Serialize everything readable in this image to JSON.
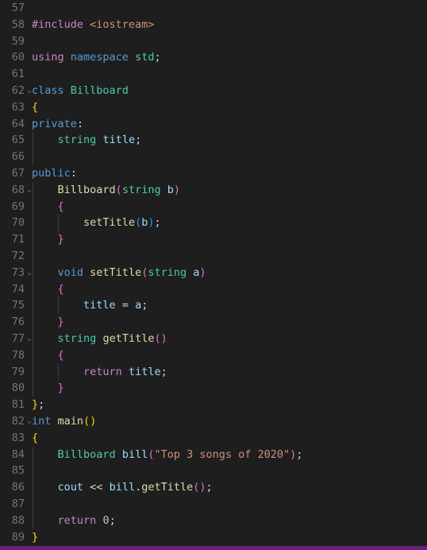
{
  "editor": {
    "language": "cpp",
    "theme": "dark-plus",
    "background_color": "#1e1e1e",
    "line_number_color": "#6e7681",
    "status_bar_color": "#68217a",
    "first_visible_line": 57,
    "last_visible_line": 89,
    "fold_chevron": "⌄",
    "lines": [
      {
        "num": "57",
        "fold": false,
        "guides": 0,
        "tokens": []
      },
      {
        "num": "58",
        "fold": false,
        "guides": 0,
        "tokens": [
          {
            "t": "#include ",
            "c": "t-pre"
          },
          {
            "t": "<iostream>",
            "c": "t-str"
          }
        ]
      },
      {
        "num": "59",
        "fold": false,
        "guides": 0,
        "tokens": []
      },
      {
        "num": "60",
        "fold": false,
        "guides": 0,
        "tokens": [
          {
            "t": "using ",
            "c": "t-pre"
          },
          {
            "t": "namespace ",
            "c": "t-kw"
          },
          {
            "t": "std",
            "c": "t-type"
          },
          {
            "t": ";",
            "c": "t-plain"
          }
        ]
      },
      {
        "num": "61",
        "fold": false,
        "guides": 0,
        "tokens": []
      },
      {
        "num": "62",
        "fold": true,
        "guides": 0,
        "tokens": [
          {
            "t": "class ",
            "c": "t-kw"
          },
          {
            "t": "Billboard",
            "c": "t-type"
          }
        ]
      },
      {
        "num": "63",
        "fold": false,
        "guides": 0,
        "tokens": [
          {
            "t": "{",
            "c": "t-br1"
          }
        ]
      },
      {
        "num": "64",
        "fold": false,
        "guides": 0,
        "tokens": [
          {
            "t": "private",
            "c": "t-kw"
          },
          {
            "t": ":",
            "c": "t-plain"
          }
        ]
      },
      {
        "num": "65",
        "fold": false,
        "guides": 1,
        "tokens": [
          {
            "t": "    ",
            "c": "t-plain"
          },
          {
            "t": "string",
            "c": "t-type"
          },
          {
            "t": " ",
            "c": "t-plain"
          },
          {
            "t": "title",
            "c": "t-var"
          },
          {
            "t": ";",
            "c": "t-plain"
          }
        ]
      },
      {
        "num": "66",
        "fold": false,
        "guides": 1,
        "tokens": []
      },
      {
        "num": "67",
        "fold": false,
        "guides": 0,
        "tokens": [
          {
            "t": "public",
            "c": "t-kw"
          },
          {
            "t": ":",
            "c": "t-plain"
          }
        ]
      },
      {
        "num": "68",
        "fold": true,
        "guides": 1,
        "tokens": [
          {
            "t": "    ",
            "c": "t-plain"
          },
          {
            "t": "Billboard",
            "c": "t-fn"
          },
          {
            "t": "(",
            "c": "t-br2"
          },
          {
            "t": "string",
            "c": "t-type"
          },
          {
            "t": " ",
            "c": "t-plain"
          },
          {
            "t": "b",
            "c": "t-var"
          },
          {
            "t": ")",
            "c": "t-br2"
          }
        ]
      },
      {
        "num": "69",
        "fold": false,
        "guides": 1,
        "tokens": [
          {
            "t": "    ",
            "c": "t-plain"
          },
          {
            "t": "{",
            "c": "t-br2"
          }
        ]
      },
      {
        "num": "70",
        "fold": false,
        "guides": 2,
        "tokens": [
          {
            "t": "        ",
            "c": "t-plain"
          },
          {
            "t": "setTitle",
            "c": "t-fn"
          },
          {
            "t": "(",
            "c": "t-br3"
          },
          {
            "t": "b",
            "c": "t-var"
          },
          {
            "t": ")",
            "c": "t-br3"
          },
          {
            "t": ";",
            "c": "t-plain"
          }
        ]
      },
      {
        "num": "71",
        "fold": false,
        "guides": 1,
        "tokens": [
          {
            "t": "    ",
            "c": "t-plain"
          },
          {
            "t": "}",
            "c": "t-br2"
          }
        ]
      },
      {
        "num": "72",
        "fold": false,
        "guides": 1,
        "tokens": []
      },
      {
        "num": "73",
        "fold": true,
        "guides": 1,
        "tokens": [
          {
            "t": "    ",
            "c": "t-plain"
          },
          {
            "t": "void",
            "c": "t-kw"
          },
          {
            "t": " ",
            "c": "t-plain"
          },
          {
            "t": "setTitle",
            "c": "t-fn"
          },
          {
            "t": "(",
            "c": "t-br2"
          },
          {
            "t": "string",
            "c": "t-type"
          },
          {
            "t": " ",
            "c": "t-plain"
          },
          {
            "t": "a",
            "c": "t-var"
          },
          {
            "t": ")",
            "c": "t-br2"
          }
        ]
      },
      {
        "num": "74",
        "fold": false,
        "guides": 1,
        "tokens": [
          {
            "t": "    ",
            "c": "t-plain"
          },
          {
            "t": "{",
            "c": "t-br2"
          }
        ]
      },
      {
        "num": "75",
        "fold": false,
        "guides": 2,
        "tokens": [
          {
            "t": "        ",
            "c": "t-plain"
          },
          {
            "t": "title",
            "c": "t-var"
          },
          {
            "t": " ",
            "c": "t-plain"
          },
          {
            "t": "=",
            "c": "t-plain"
          },
          {
            "t": " ",
            "c": "t-plain"
          },
          {
            "t": "a",
            "c": "t-var"
          },
          {
            "t": ";",
            "c": "t-plain"
          }
        ]
      },
      {
        "num": "76",
        "fold": false,
        "guides": 1,
        "tokens": [
          {
            "t": "    ",
            "c": "t-plain"
          },
          {
            "t": "}",
            "c": "t-br2"
          }
        ]
      },
      {
        "num": "77",
        "fold": true,
        "guides": 1,
        "tokens": [
          {
            "t": "    ",
            "c": "t-plain"
          },
          {
            "t": "string",
            "c": "t-type"
          },
          {
            "t": " ",
            "c": "t-plain"
          },
          {
            "t": "getTitle",
            "c": "t-fn"
          },
          {
            "t": "(",
            "c": "t-br2"
          },
          {
            "t": ")",
            "c": "t-br2"
          }
        ]
      },
      {
        "num": "78",
        "fold": false,
        "guides": 1,
        "tokens": [
          {
            "t": "    ",
            "c": "t-plain"
          },
          {
            "t": "{",
            "c": "t-br2"
          }
        ]
      },
      {
        "num": "79",
        "fold": false,
        "guides": 2,
        "tokens": [
          {
            "t": "        ",
            "c": "t-plain"
          },
          {
            "t": "return",
            "c": "t-pre"
          },
          {
            "t": " ",
            "c": "t-plain"
          },
          {
            "t": "title",
            "c": "t-var"
          },
          {
            "t": ";",
            "c": "t-plain"
          }
        ]
      },
      {
        "num": "80",
        "fold": false,
        "guides": 1,
        "tokens": [
          {
            "t": "    ",
            "c": "t-plain"
          },
          {
            "t": "}",
            "c": "t-br2"
          }
        ]
      },
      {
        "num": "81",
        "fold": false,
        "guides": 0,
        "tokens": [
          {
            "t": "}",
            "c": "t-br1"
          },
          {
            "t": ";",
            "c": "t-plain"
          }
        ]
      },
      {
        "num": "82",
        "fold": true,
        "guides": 0,
        "tokens": [
          {
            "t": "int",
            "c": "t-kw"
          },
          {
            "t": " ",
            "c": "t-plain"
          },
          {
            "t": "main",
            "c": "t-fn"
          },
          {
            "t": "(",
            "c": "t-br1"
          },
          {
            "t": ")",
            "c": "t-br1"
          }
        ]
      },
      {
        "num": "83",
        "fold": false,
        "guides": 0,
        "tokens": [
          {
            "t": "{",
            "c": "t-br1"
          }
        ]
      },
      {
        "num": "84",
        "fold": false,
        "guides": 1,
        "tokens": [
          {
            "t": "    ",
            "c": "t-plain"
          },
          {
            "t": "Billboard",
            "c": "t-type"
          },
          {
            "t": " ",
            "c": "t-plain"
          },
          {
            "t": "bill",
            "c": "t-var"
          },
          {
            "t": "(",
            "c": "t-br2"
          },
          {
            "t": "\"Top 3 songs of 2020\"",
            "c": "t-str"
          },
          {
            "t": ")",
            "c": "t-br2"
          },
          {
            "t": ";",
            "c": "t-plain"
          }
        ]
      },
      {
        "num": "85",
        "fold": false,
        "guides": 1,
        "tokens": []
      },
      {
        "num": "86",
        "fold": false,
        "guides": 1,
        "tokens": [
          {
            "t": "    ",
            "c": "t-plain"
          },
          {
            "t": "cout",
            "c": "t-var"
          },
          {
            "t": " ",
            "c": "t-plain"
          },
          {
            "t": "<<",
            "c": "t-plain"
          },
          {
            "t": " ",
            "c": "t-plain"
          },
          {
            "t": "bill",
            "c": "t-var"
          },
          {
            "t": ".",
            "c": "t-plain"
          },
          {
            "t": "getTitle",
            "c": "t-fn"
          },
          {
            "t": "(",
            "c": "t-br2"
          },
          {
            "t": ")",
            "c": "t-br2"
          },
          {
            "t": ";",
            "c": "t-plain"
          }
        ]
      },
      {
        "num": "87",
        "fold": false,
        "guides": 1,
        "tokens": []
      },
      {
        "num": "88",
        "fold": false,
        "guides": 1,
        "tokens": [
          {
            "t": "    ",
            "c": "t-plain"
          },
          {
            "t": "return",
            "c": "t-pre"
          },
          {
            "t": " ",
            "c": "t-plain"
          },
          {
            "t": "0",
            "c": "t-num"
          },
          {
            "t": ";",
            "c": "t-plain"
          }
        ]
      },
      {
        "num": "89",
        "fold": false,
        "guides": 0,
        "tokens": [
          {
            "t": "}",
            "c": "t-br1"
          }
        ]
      }
    ],
    "source_text": "#include <iostream>\n\nusing namespace std;\n\nclass Billboard\n{\nprivate:\n    string title;\n\npublic:\n    Billboard(string b)\n    {\n        setTitle(b);\n    }\n\n    void setTitle(string a)\n    {\n        title = a;\n    }\n    string getTitle()\n    {\n        return title;\n    }\n};\nint main()\n{\n    Billboard bill(\"Top 3 songs of 2020\");\n\n    cout << bill.getTitle();\n\n    return 0;\n}"
  }
}
